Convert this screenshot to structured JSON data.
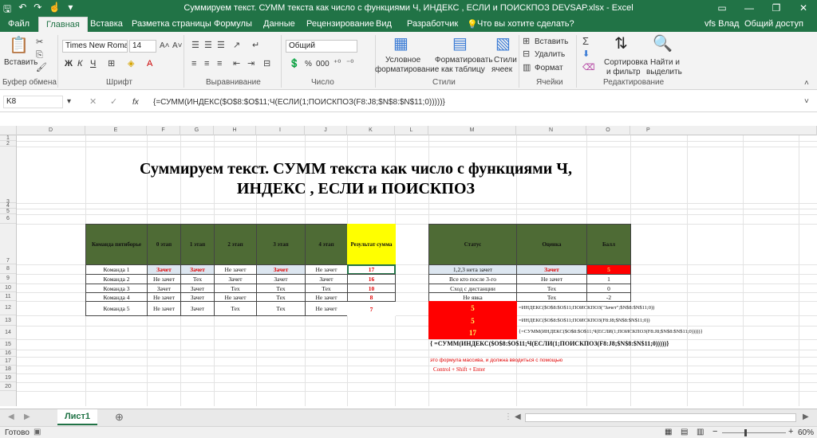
{
  "titlebar": {
    "window_title": "Суммируем текст. СУММ текста  как число с функциями Ч, ИНДЕКС , ЕСЛИ и ПОИСКПОЗ DEVSAP.xlsx - Excel",
    "minimize": "—",
    "restore": "❐",
    "close": "✕"
  },
  "tabs": {
    "file": "Файл",
    "home": "Главная",
    "insert": "Вставка",
    "layout": "Разметка страницы",
    "formulas": "Формулы",
    "data": "Данные",
    "review": "Рецензирование",
    "view": "Вид",
    "developer": "Разработчик",
    "tell": "Что вы хотите сделать?",
    "user": "vfs Влад",
    "share": "Общий доступ"
  },
  "ribbon": {
    "paste": "Вставить",
    "clipboard": "Буфер обмена",
    "font_name": "Times New Roma",
    "font_size": "14",
    "bold": "Ж",
    "italic": "К",
    "underline": "Ч",
    "font_group": "Шрифт",
    "align_group": "Выравнивание",
    "number_format": "Общий",
    "percent": "%",
    "thousands": "000",
    "number_group": "Число",
    "cond1": "Условное",
    "cond2": "форматирование",
    "fmt_table1": "Форматировать",
    "fmt_table2": "как таблицу",
    "styles1": "Стили",
    "styles2": "ячеек",
    "styles_group": "Стили",
    "insert": "Вставить",
    "delete": "Удалить",
    "format": "Формат",
    "cells_group": "Ячейки",
    "sort1": "Сортировка",
    "sort2": "и фильтр",
    "find1": "Найти и",
    "find2": "выделить",
    "edit_group": "Редактирование"
  },
  "formula_bar": {
    "name_box": "K8",
    "fx": "fx",
    "formula": "{=СУММ(ИНДЕКС($O$8:$O$11;Ч(ЕСЛИ(1;ПОИСКПОЗ(F8:J8;$N$8:$N$11;0)))))}"
  },
  "columns": [
    "D",
    "E",
    "F",
    "G",
    "H",
    "I",
    "J",
    "K",
    "L",
    "M",
    "N",
    "O",
    "P"
  ],
  "rows": [
    "1",
    "2",
    "3",
    "4",
    "5",
    "6",
    "7",
    "8",
    "9",
    "10",
    "11",
    "12",
    "13",
    "14",
    "15",
    "16",
    "17",
    "18",
    "19",
    "20"
  ],
  "sheet_title": "Суммируем текст. СУММ текста  как число с функциями Ч, ИНДЕКС , ЕСЛИ и ПОИСКПОЗ",
  "left_table": {
    "headers": [
      "Команда пятиборье",
      "0 этап",
      "1 этап",
      "2 этап",
      "3 этап",
      "4 этап",
      "Результат сумма"
    ],
    "rows": [
      [
        "Команда 1",
        "Зачет",
        "Зачет",
        "Не зачет",
        "Зачет",
        "Не зачет",
        "17"
      ],
      [
        "Команда 2",
        "Не зачет",
        "Тех",
        "Зачет",
        "Зачет",
        "Зачет",
        "16"
      ],
      [
        "Команда 3",
        "Зачет",
        "Зачет",
        "Тех",
        "Тех",
        "Тех",
        "10"
      ],
      [
        "Команда 4",
        "Не зачет",
        "Зачет",
        "Не зачет",
        "Тех",
        "Не зачет",
        "8"
      ],
      [
        "Команда 5",
        "Не зачет",
        "Зачет",
        "Тех",
        "Тех",
        "Не зачет",
        "7"
      ]
    ]
  },
  "right_table": {
    "headers": [
      "Статус",
      "Оценка",
      "Балл"
    ],
    "rows": [
      [
        "1,2,3 нета зачет",
        "Зачет",
        "5"
      ],
      [
        "Все кто после 3-го",
        "Не зачет",
        "1"
      ],
      [
        "Сход с дистанции",
        "Тех",
        "0"
      ],
      [
        "Не явка",
        "Тех",
        "-2"
      ]
    ]
  },
  "results": {
    "r12": "5",
    "r13": "5",
    "r14": "17",
    "f12": "=ИНДЕКС($O$8:$O$11;ПОИСКПОЗ(\"Зачет\";$N$8:$N$11;0))",
    "f13": "=ИНДЕКС($O$8:$O$11;ПОИСКПОЗ(F8:J8;$N$8:$N$11;0))",
    "f14": "{=СУММ(ИНДЕКС($O$8:$O$11;Ч(ЕСЛИ(1;ПОИСКПОЗ(F8:J8;$N$8:$N$11;0)))))}",
    "f15": "{ =СУММ(ИНДЕКС($O$8:$O$11;Ч(ЕСЛИ(1;ПОИСКПОЗ(F8:J8;$N$8:$N$11;0)))))}",
    "note1": "это формула массива, и должна вводиться с помощью",
    "note2": "Control + Shift + Enter"
  },
  "sheet_tab": "Лист1",
  "status": {
    "ready": "Готово",
    "zoom": "60%"
  },
  "colors": {
    "excel_green": "#217346",
    "header_fill": "#4e6b35",
    "highlight_red": "#ff0000",
    "result_yellow": "#ffff00"
  }
}
